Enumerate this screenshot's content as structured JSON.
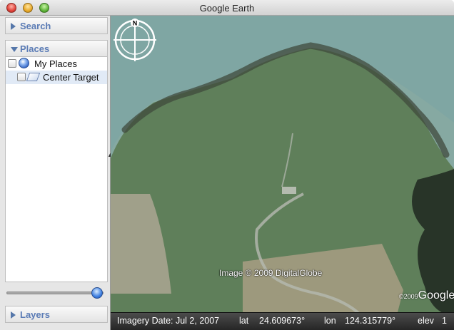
{
  "window": {
    "title": "Google Earth"
  },
  "sidebar": {
    "search_label": "Search",
    "places_label": "Places",
    "layers_label": "Layers",
    "tree": [
      {
        "label": "My Places",
        "icon": "globe-icon",
        "checked": false,
        "selected": false
      },
      {
        "label": "Center Target",
        "icon": "placemark-folder-icon",
        "checked": false,
        "selected": true
      }
    ],
    "slider_value": 0.95
  },
  "map": {
    "copyright": "Image © 2009 DigitalGlobe",
    "logo": "Google",
    "logo_prefix": "©2009",
    "compass_north": "N"
  },
  "status": {
    "imagery_date": "Imagery Date: Jul  2, 2007",
    "lat_label": "lat",
    "lat_value": "24.609673°",
    "lon_label": "lon",
    "lon_value": "124.315779°",
    "elev_label": "elev",
    "elev_value": "1"
  },
  "colors": {
    "accent": "#5a7bb5",
    "selection": "#e1eaf6",
    "statusbar": "#262626"
  }
}
